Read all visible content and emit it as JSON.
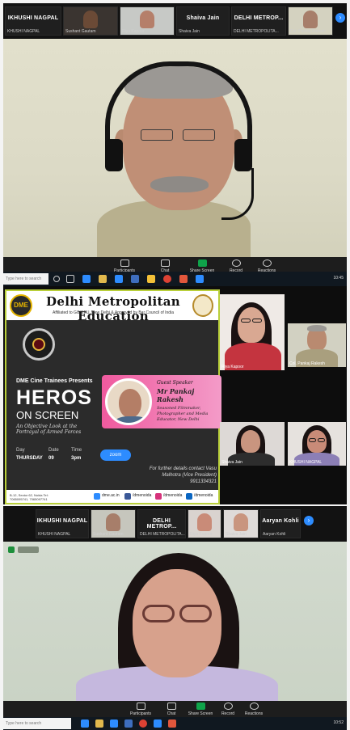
{
  "top": {
    "strip": [
      {
        "name": "IKHUSHI NAGPAL",
        "label": "KHUSHI NAGPAL"
      },
      {
        "name": "",
        "label": "Sushant Gautam"
      },
      {
        "name": "",
        "label": "Riya Kapoor"
      },
      {
        "name": "Shaiva Jain",
        "label": "Shaiva Jain"
      },
      {
        "name": "DELHI METROP...",
        "label": "DELHI METROPOLITA..."
      },
      {
        "name": "",
        "label": "Col. Pankaj Rakesh"
      }
    ],
    "toolbar": [
      "Participants",
      "Chat",
      "Share Screen",
      "Record",
      "Reactions"
    ],
    "search_placeholder": "Type here to search",
    "time": "10:45"
  },
  "poster": {
    "logo_text": "DME",
    "institute": "Delhi Metropolitan Education",
    "affiliation": "Affiliated to GGSIPU, New Delhi & Approved by Bar Council of India",
    "presents": "DME Cine Trainees Presents",
    "title": "HEROS",
    "subtitle": "ON SCREEN",
    "objective": "An Objective Look at the Portrayal of Armed Forces",
    "guest_label": "Guest Speaker",
    "speaker_name": "Mr Pankaj Rakesh",
    "speaker_role": "Seasoned Filmmaker, Photographer and Media Educator, New Delhi",
    "day_label": "Day",
    "day_value": "THURSDAY",
    "date_label": "Date",
    "date_value": "09",
    "time_label": "Time",
    "time_value": "3pm",
    "zoom_label": "zoom",
    "contact": "For further details contact Vasu Malhotra (Vice President) 9911334321",
    "address": "B-12, Sector 62, Noida  Tel: 7065095741, 7065097741",
    "social": [
      "dme.ac.in",
      "/dmenoida",
      "/dmenoida",
      "/dmenoida"
    ]
  },
  "gallery": [
    {
      "label": "Riya Kapoor"
    },
    {
      "label": "Col. Pankaj Rakesh"
    },
    {
      "label": "Shaiva Jain"
    },
    {
      "label": "KHUSHI NAGPAL"
    }
  ],
  "bottom": {
    "strip": [
      {
        "name": "IKHUSHI NAGPAL",
        "label": "KHUSHI NAGPAL"
      },
      {
        "name": "",
        "label": "Sushant Gautam"
      },
      {
        "name": "DELHI METROP...",
        "label": "DELHI METROPOLITA..."
      },
      {
        "name": "",
        "label": "Riya Kapoor"
      },
      {
        "name": "",
        "label": "Shaiva Jain"
      },
      {
        "name": "Aaryan Kohli",
        "label": "Aaryan Kohli"
      }
    ],
    "toolbar": [
      "Participants",
      "Chat",
      "Share Screen",
      "Record",
      "Reactions"
    ],
    "search_placeholder": "Type here to search",
    "time": "10:52"
  }
}
